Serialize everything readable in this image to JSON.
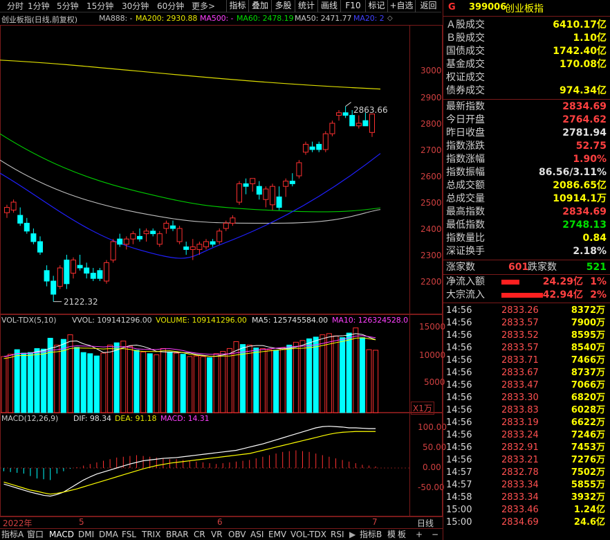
{
  "toolbar": {
    "periods": [
      "分时",
      "1分钟",
      "5分钟",
      "15分钟",
      "30分钟",
      "60分钟"
    ],
    "more": "更多>",
    "right_buttons": [
      "指标",
      "叠加",
      "多股",
      "统计",
      "画线",
      "F10",
      "标记",
      "+自选",
      "返回"
    ]
  },
  "price_panel": {
    "title": "创业板指(日线,前复权)",
    "ma888": "MA888: -",
    "ma200": "MA200: 2930.88",
    "ma500": "MA500: -",
    "ma60": "MA60: 2478.19",
    "ma50": "MA50: 2471.77",
    "ma20": "MA20: 2",
    "high_label": "2863.66",
    "low_label": "2122.32",
    "y_ticks": [
      "3000",
      "2900",
      "2800",
      "2700",
      "2600",
      "2500",
      "2400",
      "2300",
      "2200"
    ]
  },
  "volume_panel": {
    "name": "VOL-TDX(5,10)",
    "vvol": "VVOL: 109141296.00",
    "volume": "VOLUME: 109141296.00",
    "ma5": "MA5: 125745584.00",
    "ma10": "MA10: 126324528.0",
    "y_ticks": [
      "15000",
      "10000",
      "5000"
    ],
    "unit": "X1万"
  },
  "macd_panel": {
    "name": "MACD(12,26,9)",
    "dif": "DIF: 98.34",
    "dea": "DEA: 91.18",
    "macd": "MACD: 14.31",
    "y_ticks": [
      "100.00",
      "50.00",
      "0.00",
      "-50.00"
    ]
  },
  "date_axis": {
    "year": "2022年",
    "m5": "5",
    "m6": "6",
    "m7": "7",
    "period": "日线"
  },
  "bottom_tabs": [
    "指标A",
    "窗口",
    "MACD",
    "DMI",
    "DMA",
    "FSL",
    "TRIX",
    "BRAR",
    "CR",
    "VR",
    "OBV",
    "ASI",
    "EMV",
    "VOL-TDX",
    "RSI"
  ],
  "bottom_right": [
    "指标B",
    "模",
    "板",
    "+",
    "−"
  ],
  "header": {
    "flag": "G",
    "code": "399006",
    "name": "创业板指"
  },
  "turnover": [
    {
      "label": "Ａ股成交",
      "value": "6410.17亿"
    },
    {
      "label": "Ｂ股成交",
      "value": "1.10亿"
    },
    {
      "label": "国债成交",
      "value": "1742.40亿"
    },
    {
      "label": "基金成交",
      "value": "170.08亿"
    },
    {
      "label": "权证成交",
      "value": ""
    },
    {
      "label": "债券成交",
      "value": "974.34亿"
    }
  ],
  "quotes": [
    {
      "label": "最新指数",
      "value": "2834.69",
      "color": "#ff4040"
    },
    {
      "label": "今日开盘",
      "value": "2764.62",
      "color": "#ff4040"
    },
    {
      "label": "昨日收盘",
      "value": "2781.94",
      "color": "#e0e0e0"
    },
    {
      "label": "指数涨跌",
      "value": "52.75",
      "color": "#ff4040"
    },
    {
      "label": "指数涨幅",
      "value": "1.90%",
      "color": "#ff4040"
    },
    {
      "label": "指数振幅",
      "value": "86.56/3.11%",
      "color": "#e0e0e0"
    },
    {
      "label": "总成交额",
      "value": "2086.65亿",
      "color": "#ffff00"
    },
    {
      "label": "总成交量",
      "value": "10914.1万",
      "color": "#ffff00"
    },
    {
      "label": "最高指数",
      "value": "2834.69",
      "color": "#ff4040"
    },
    {
      "label": "最低指数",
      "value": "2748.13",
      "color": "#00e000"
    },
    {
      "label": "指数量比",
      "value": "0.84",
      "color": "#ffff00"
    },
    {
      "label": "深证换手",
      "value": "2.18%",
      "color": "#e0e0e0"
    }
  ],
  "breadth": {
    "up_label": "涨家数",
    "up": "601",
    "down_label": "跌家数",
    "down": "521"
  },
  "flows": [
    {
      "label": "净流入额",
      "value": "24.29亿",
      "pct": "1%",
      "bar": 0.33
    },
    {
      "label": "大宗流入",
      "value": "42.94亿",
      "pct": "2%",
      "bar": 0.75
    }
  ],
  "ticks": [
    {
      "t": "14:56",
      "p": "2833.26",
      "v": "8372万"
    },
    {
      "t": "14:56",
      "p": "2833.57",
      "v": "7900万"
    },
    {
      "t": "14:56",
      "p": "2833.52",
      "v": "8595万"
    },
    {
      "t": "14:56",
      "p": "2833.57",
      "v": "8540万"
    },
    {
      "t": "14:56",
      "p": "2833.71",
      "v": "7466万"
    },
    {
      "t": "14:56",
      "p": "2833.67",
      "v": "8737万"
    },
    {
      "t": "14:56",
      "p": "2833.47",
      "v": "7066万"
    },
    {
      "t": "14:56",
      "p": "2833.30",
      "v": "6820万"
    },
    {
      "t": "14:56",
      "p": "2833.83",
      "v": "6028万"
    },
    {
      "t": "14:56",
      "p": "2833.19",
      "v": "6622万"
    },
    {
      "t": "14:56",
      "p": "2833.24",
      "v": "7246万"
    },
    {
      "t": "14:56",
      "p": "2832.91",
      "v": "7453万"
    },
    {
      "t": "14:56",
      "p": "2833.21",
      "v": "7276万"
    },
    {
      "t": "14:57",
      "p": "2832.78",
      "v": "7502万"
    },
    {
      "t": "14:57",
      "p": "2833.34",
      "v": "5855万"
    },
    {
      "t": "14:58",
      "p": "2833.34",
      "v": "3932万"
    },
    {
      "t": "15:00",
      "p": "2833.46",
      "v": "1.24亿"
    },
    {
      "t": "15:00",
      "p": "2834.69",
      "v": "24.6亿"
    }
  ],
  "chart_data": {
    "type": "candlestick",
    "y_range": [
      2122.32,
      2863.66
    ],
    "candles": [
      [
        2460,
        2490,
        2440,
        2480
      ],
      [
        2470,
        2510,
        2460,
        2500
      ],
      [
        2450,
        2480,
        2410,
        2420
      ],
      [
        2420,
        2440,
        2380,
        2390
      ],
      [
        2380,
        2400,
        2340,
        2350
      ],
      [
        2350,
        2370,
        2300,
        2310
      ],
      [
        2240,
        2260,
        2180,
        2200
      ],
      [
        2200,
        2220,
        2122,
        2150
      ],
      [
        2180,
        2260,
        2170,
        2250
      ],
      [
        2280,
        2300,
        2170,
        2190
      ],
      [
        2230,
        2290,
        2210,
        2280
      ],
      [
        2260,
        2300,
        2240,
        2250
      ],
      [
        2250,
        2270,
        2210,
        2230
      ],
      [
        2230,
        2250,
        2200,
        2210
      ],
      [
        2240,
        2250,
        2200,
        2210
      ],
      [
        2200,
        2280,
        2190,
        2270
      ],
      [
        2280,
        2360,
        2270,
        2350
      ],
      [
        2360,
        2380,
        2330,
        2340
      ],
      [
        2340,
        2370,
        2320,
        2360
      ],
      [
        2360,
        2390,
        2340,
        2380
      ],
      [
        2370,
        2400,
        2350,
        2360
      ],
      [
        2380,
        2400,
        2350,
        2390
      ],
      [
        2390,
        2400,
        2370,
        2380
      ],
      [
        2340,
        2390,
        2330,
        2380
      ],
      [
        2400,
        2430,
        2380,
        2420
      ],
      [
        2410,
        2430,
        2390,
        2400
      ],
      [
        2350,
        2410,
        2340,
        2400
      ],
      [
        2330,
        2350,
        2300,
        2320
      ],
      [
        2320,
        2360,
        2280,
        2330
      ],
      [
        2320,
        2350,
        2300,
        2340
      ],
      [
        2330,
        2360,
        2320,
        2350
      ],
      [
        2350,
        2360,
        2330,
        2340
      ],
      [
        2350,
        2400,
        2340,
        2390
      ],
      [
        2400,
        2430,
        2390,
        2420
      ],
      [
        2420,
        2450,
        2410,
        2440
      ],
      [
        2500,
        2580,
        2490,
        2570
      ],
      [
        2570,
        2590,
        2530,
        2560
      ],
      [
        2570,
        2580,
        2540,
        2590
      ],
      [
        2560,
        2580,
        2510,
        2530
      ],
      [
        2510,
        2560,
        2480,
        2550
      ],
      [
        2490,
        2570,
        2470,
        2560
      ],
      [
        2520,
        2560,
        2470,
        2480
      ],
      [
        2560,
        2590,
        2520,
        2580
      ],
      [
        2580,
        2610,
        2560,
        2570
      ],
      [
        2600,
        2660,
        2590,
        2650
      ],
      [
        2690,
        2730,
        2680,
        2720
      ],
      [
        2710,
        2730,
        2690,
        2700
      ],
      [
        2720,
        2730,
        2690,
        2700
      ],
      [
        2700,
        2770,
        2690,
        2760
      ],
      [
        2760,
        2810,
        2750,
        2800
      ],
      [
        2830,
        2850,
        2810,
        2840
      ],
      [
        2840,
        2864,
        2820,
        2830
      ],
      [
        2830,
        2850,
        2790,
        2790
      ],
      [
        2790,
        2830,
        2780,
        2800
      ],
      [
        2810,
        2840,
        2800,
        2790
      ],
      [
        2765,
        2835,
        2748,
        2835
      ]
    ],
    "volumes": [
      9800,
      10200,
      11000,
      10400,
      10500,
      11200,
      11100,
      13000,
      11800,
      12800,
      13600,
      11400,
      10500,
      10300,
      9900,
      10400,
      11800,
      12200,
      12500,
      11600,
      10900,
      10600,
      10300,
      10100,
      11200,
      10600,
      10400,
      10200,
      9800,
      9900,
      9800,
      9600,
      10300,
      10700,
      11200,
      12400,
      11900,
      11800,
      11300,
      11200,
      11000,
      10900,
      11300,
      11800,
      12300,
      12600,
      12900,
      13200,
      13600,
      13800,
      13400,
      13100,
      13900,
      14800,
      13100,
      11000,
      10900
    ],
    "macd_hist": [
      -8,
      -10,
      -12,
      -14,
      -20,
      -26,
      -28,
      -30,
      -14,
      -8,
      -2,
      2,
      6,
      10,
      14,
      18,
      22,
      26,
      28,
      30,
      32,
      30,
      28,
      26,
      24,
      22,
      22,
      20,
      18,
      16,
      14,
      12,
      10,
      12,
      14,
      16,
      18,
      20,
      24,
      28,
      32,
      36,
      40,
      42,
      44,
      42,
      40,
      36,
      32,
      28,
      24,
      20,
      16,
      12,
      8,
      6,
      4
    ],
    "dif": [
      -40,
      -45,
      -50,
      -55,
      -60,
      -64,
      -68,
      -70,
      -66,
      -60,
      -50,
      -40,
      -30,
      -22,
      -15,
      -10,
      -5,
      0,
      5,
      10,
      14,
      18,
      20,
      22,
      24,
      25,
      26,
      28,
      30,
      32,
      34,
      36,
      38,
      40,
      42,
      44,
      48,
      52,
      56,
      60,
      65,
      70,
      75,
      80,
      85,
      90,
      95,
      100,
      103,
      104,
      103,
      102,
      100,
      100,
      99,
      98,
      98
    ],
    "dea": [
      -35,
      -40,
      -45,
      -50,
      -55,
      -58,
      -62,
      -65,
      -63,
      -60,
      -56,
      -52,
      -47,
      -42,
      -37,
      -32,
      -27,
      -22,
      -17,
      -12,
      -7,
      -2,
      2,
      6,
      9,
      12,
      14,
      16,
      18,
      20,
      22,
      24,
      26,
      28,
      30,
      32,
      34,
      36,
      40,
      44,
      48,
      52,
      56,
      60,
      64,
      68,
      72,
      76,
      80,
      84,
      87,
      89,
      90,
      91,
      91,
      91,
      91
    ]
  },
  "colors": {
    "up": "#ff3030",
    "down": "#00ffff",
    "ma5": "#ffffff",
    "ma10": "#ffff00",
    "ma20": "#2020ff",
    "ma50": "#c0c0c0",
    "ma60": "#00cc00",
    "ma200": "#dddd00"
  }
}
